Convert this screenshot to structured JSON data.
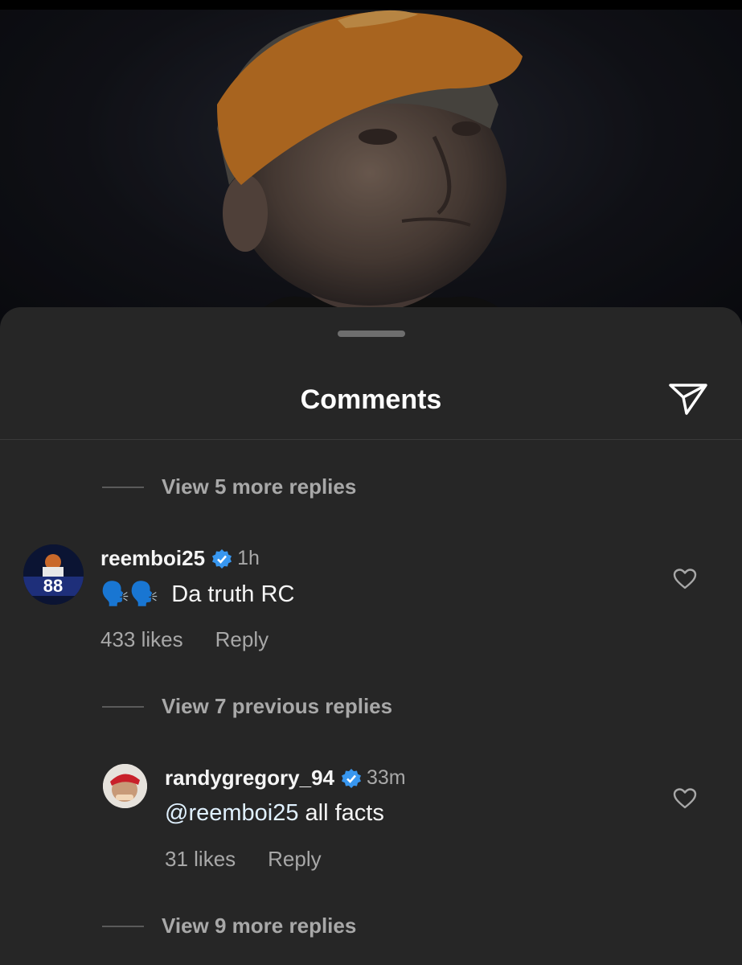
{
  "sheet": {
    "title": "Comments"
  },
  "threads": [
    {
      "text": "View 5 more replies"
    },
    {
      "text": "View 7 previous replies"
    },
    {
      "text": "View 9 more replies"
    }
  ],
  "comments": [
    {
      "username": "reemboi25",
      "time": "1h",
      "emoji": "🗣️🗣️",
      "text": "Da truth RC",
      "likes": "433 likes",
      "reply": "Reply",
      "avatar_number": "88"
    },
    {
      "username": "randygregory_94",
      "time": "33m",
      "mention": "@reemboi25",
      "text": " all facts",
      "likes": "31 likes",
      "reply": "Reply"
    }
  ],
  "colors": {
    "verified": "#3897f0",
    "sheet": "#262626",
    "secondary_text": "#a8a8a8"
  },
  "icons": [
    "send-icon",
    "verified-badge-icon",
    "heart-icon"
  ]
}
